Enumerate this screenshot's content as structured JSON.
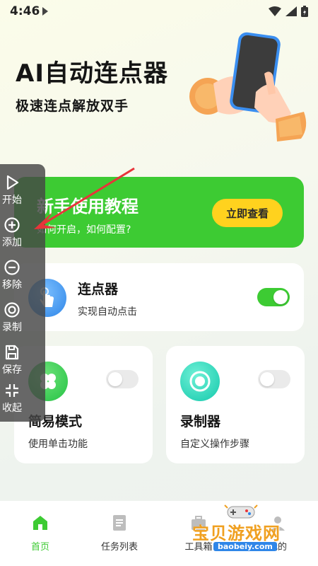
{
  "status": {
    "time": "4:46"
  },
  "header": {
    "title": "AI自动连点器",
    "subtitle": "极速连点解放双手"
  },
  "tutorial": {
    "title": "新手使用教程",
    "subtitle": "如何开启，如何配置?",
    "button": "立即查看"
  },
  "clicker": {
    "title": "连点器",
    "subtitle": "实现自动点击",
    "enabled": true
  },
  "modes": [
    {
      "title": "简易模式",
      "subtitle": "使用单击功能",
      "enabled": false
    },
    {
      "title": "录制器",
      "subtitle": "自定义操作步骤",
      "enabled": false
    }
  ],
  "floating_toolbar": {
    "items": [
      {
        "label": "开始",
        "icon": "play-icon"
      },
      {
        "label": "添加",
        "icon": "plus-circle-icon"
      },
      {
        "label": "移除",
        "icon": "minus-circle-icon"
      },
      {
        "label": "录制",
        "icon": "record-icon"
      },
      {
        "label": "保存",
        "icon": "save-icon"
      },
      {
        "label": "收起",
        "icon": "collapse-icon"
      }
    ]
  },
  "bottom_nav": {
    "items": [
      {
        "label": "首页",
        "icon": "home-icon",
        "active": true
      },
      {
        "label": "任务列表",
        "icon": "list-icon",
        "active": false
      },
      {
        "label": "工具箱",
        "icon": "toolbox-icon",
        "active": false
      },
      {
        "label": "我的",
        "icon": "profile-icon",
        "active": false
      }
    ]
  },
  "watermark": {
    "text": "宝贝游戏网",
    "url": "baobeiy.com"
  },
  "colors": {
    "accent_green": "#3dcb33",
    "button_yellow": "#ffd21e",
    "clicker_blue": "#2f86e8",
    "simple_mode_green": "#2fcf4f",
    "recorder_teal": "#1fd3b6",
    "arrow_red": "#e8343a"
  }
}
